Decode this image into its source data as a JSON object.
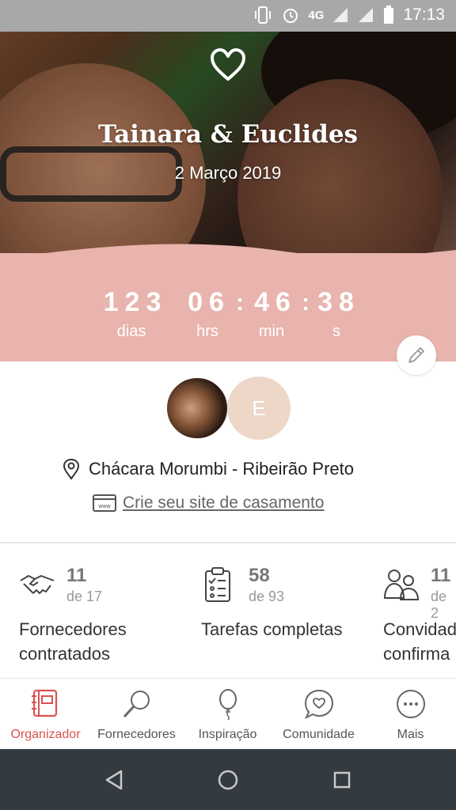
{
  "status_bar": {
    "network": "4G",
    "time": "17:13"
  },
  "hero": {
    "names": "Tainara & Euclides",
    "date": "2 Março 2019"
  },
  "countdown": {
    "days": "123",
    "days_label": "dias",
    "hours": "06",
    "hours_label": "hrs",
    "minutes": "46",
    "minutes_label": "min",
    "seconds": "38",
    "seconds_label": "s"
  },
  "profile": {
    "avatar2_initial": "E",
    "location": "Chácara Morumbi - Ribeirão Preto",
    "website_link": "Crie seu site de casamento"
  },
  "stats": [
    {
      "value": "11",
      "of": "de 17",
      "label": "Fornecedores contratados",
      "icon": "handshake-icon"
    },
    {
      "value": "58",
      "of": "de 93",
      "label": "Tarefas completas",
      "icon": "checklist-icon"
    },
    {
      "value": "11",
      "of": "de 2",
      "label": "Convidados confirma",
      "icon": "guests-icon"
    }
  ],
  "bottom_nav": [
    {
      "label": "Organizador",
      "icon": "notebook-icon",
      "active": true
    },
    {
      "label": "Fornecedores",
      "icon": "magnifier-icon"
    },
    {
      "label": "Inspiração",
      "icon": "balloon-icon"
    },
    {
      "label": "Comunidade",
      "icon": "chat-heart-icon"
    },
    {
      "label": "Mais",
      "icon": "more-dots-icon"
    }
  ],
  "colors": {
    "accent": "#d9534f",
    "band": "#e8b4ad",
    "status_bar": "#a8a8a8",
    "system_nav": "#333a40"
  }
}
